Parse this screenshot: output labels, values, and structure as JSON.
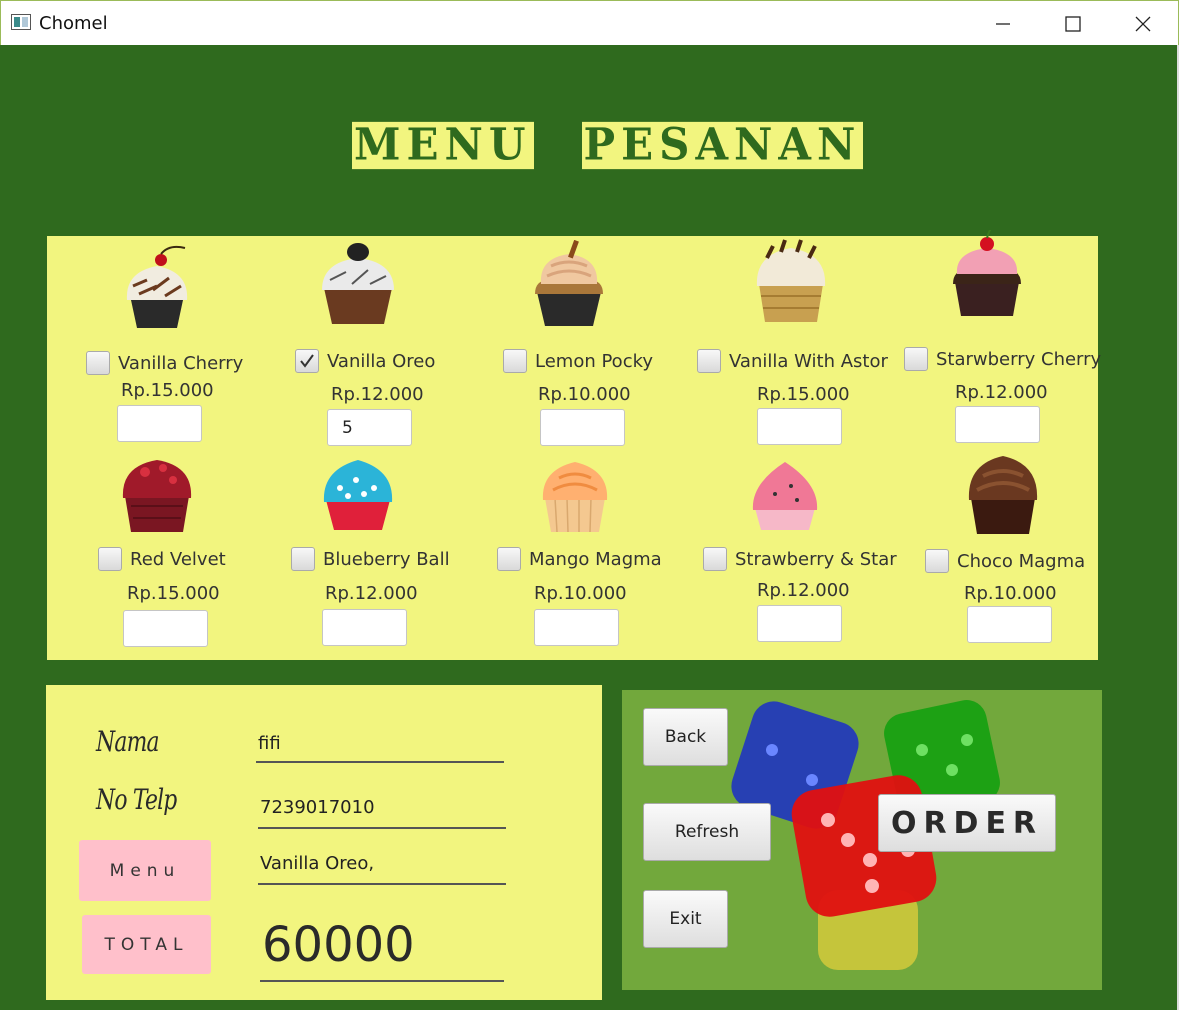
{
  "window": {
    "title": "Chomel"
  },
  "heading": {
    "word1": "MENU",
    "word2": "PESANAN"
  },
  "menu": {
    "items": [
      {
        "name": "Vanilla Cherry",
        "price": "Rp.15.000",
        "checked": false,
        "qty": ""
      },
      {
        "name": "Vanilla Oreo",
        "price": "Rp.12.000",
        "checked": true,
        "qty": "5"
      },
      {
        "name": "Lemon Pocky",
        "price": "Rp.10.000",
        "checked": false,
        "qty": ""
      },
      {
        "name": "Vanilla With Astor",
        "price": "Rp.15.000",
        "checked": false,
        "qty": ""
      },
      {
        "name": "Starwberry Cherry",
        "price": "Rp.12.000",
        "checked": false,
        "qty": ""
      },
      {
        "name": "Red Velvet",
        "price": "Rp.15.000",
        "checked": false,
        "qty": ""
      },
      {
        "name": "Blueberry Ball",
        "price": "Rp.12.000",
        "checked": false,
        "qty": ""
      },
      {
        "name": "Mango Magma",
        "price": "Rp.10.000",
        "checked": false,
        "qty": ""
      },
      {
        "name": "Strawberry & Star",
        "price": "Rp.12.000",
        "checked": false,
        "qty": ""
      },
      {
        "name": "Choco Magma",
        "price": "Rp.10.000",
        "checked": false,
        "qty": ""
      }
    ]
  },
  "form": {
    "nama_label": "Nama",
    "nama_value": "fifi",
    "telp_label": "No Telp",
    "telp_value": "7239017010",
    "menu_label": "Menu",
    "menu_value": "Vanilla Oreo,",
    "total_label": "TOTAL",
    "total_value": "60000"
  },
  "actions": {
    "back": "Back",
    "refresh": "Refresh",
    "exit": "Exit",
    "order": "ORDER"
  }
}
